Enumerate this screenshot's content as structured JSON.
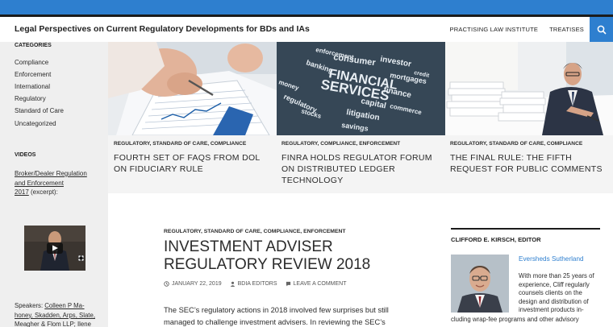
{
  "header": {
    "site_title": "Legal Perspectives on Current Regulatory Developments for BDs and IAs",
    "nav": [
      "PRACTISING LAW INSTITUTE",
      "TREATISES"
    ]
  },
  "sidebar": {
    "categories_heading": "CATEGORIES",
    "categories": [
      "Compliance",
      "Enforcement",
      "International",
      "Regulatory",
      "Standard of Care",
      "Uncategorized"
    ],
    "videos_heading": "VIDEOS",
    "video_link_line1": "Broker/Dealer Regulation",
    "video_link_line2": "and Enforcement",
    "video_link_year": "2017",
    "video_link_suffix": " (excerpt):",
    "speakers_prefix": "Speakers: ",
    "speakers_link_line1": "Colleen P Ma-",
    "speakers_link_line2": "honey, Skadden, Arps, Slate,",
    "speakers_link_line3": "Meagher & Flom LLP; Ilene"
  },
  "featured": [
    {
      "categories": "REGULATORY, STANDARD OF CARE, COMPLIANCE",
      "title": "FOURTH SET OF FAQS FROM DOL ON FIDUCIARY RULE"
    },
    {
      "categories": "REGULATORY, COMPLIANCE, ENFORCEMENT",
      "title": "FINRA HOLDS REGULATOR FORUM ON DISTRIBUTED LEDGER TECHNOLOGY"
    },
    {
      "categories": "REGULATORY, STANDARD OF CARE, COMPLIANCE",
      "title": "THE FINAL RULE: THE FIFTH REQUEST FOR PUBLIC COMMENTS"
    }
  ],
  "word_cloud": {
    "words": [
      "consumer",
      "investor",
      "credit",
      "banking",
      "mortgages",
      "enforcement",
      "SERVICES",
      "FINANCIAL",
      "capital",
      "finance",
      "money",
      "litigation",
      "regulatory",
      "commerce",
      "stocks",
      "savings"
    ]
  },
  "post": {
    "categories": "REGULATORY, STANDARD OF CARE, COMPLIANCE, ENFORCEMENT",
    "title": "INVESTMENT ADVISER REGULATORY REVIEW 2018",
    "date": "JANUARY 22, 2019",
    "author": "BDIA EDITORS",
    "comment": "LEAVE A COMMENT",
    "body": "The SEC’s regulatory actions in 2018 involved few surprises but still managed to challenge investment advisers. In reviewing the SEC’s"
  },
  "editor": {
    "heading": "CLIFFORD E. KIRSCH, EDITOR",
    "firm": "Eversheds Sutherland",
    "bio": "With more than 25 years of experience, Cliff regularly counsels clients on the design and distribution of investment products in-",
    "bio2": "cluding wrap-fee programs and other advisory"
  },
  "colors": {
    "accent": "#2e7fcf",
    "sidebar_bg": "#efefef",
    "featured_bg": "#f4f4f4"
  }
}
